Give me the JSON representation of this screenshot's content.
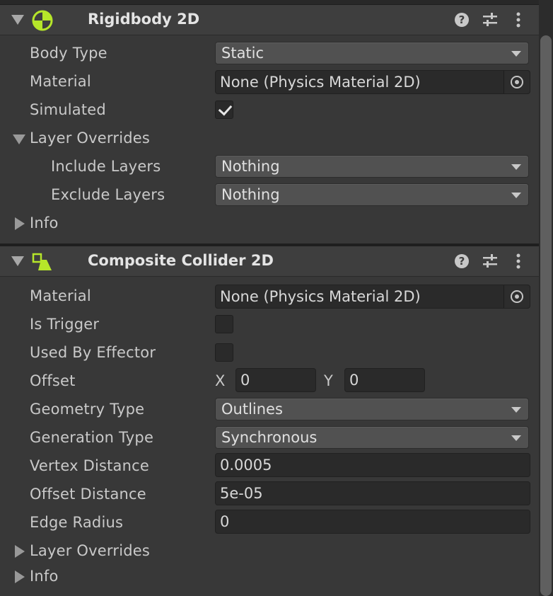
{
  "rigidbody": {
    "title": "Rigidbody 2D",
    "icon": "rigidbody2d-icon",
    "accent": "#b6e62a",
    "body_type_label": "Body Type",
    "body_type_value": "Static",
    "material_label": "Material",
    "material_value": "None (Physics Material 2D)",
    "simulated_label": "Simulated",
    "simulated_checked": true,
    "layer_overrides_label": "Layer Overrides",
    "include_layers_label": "Include Layers",
    "include_layers_value": "Nothing",
    "exclude_layers_label": "Exclude Layers",
    "exclude_layers_value": "Nothing",
    "info_label": "Info"
  },
  "composite": {
    "title": "Composite Collider 2D",
    "icon": "composite-collider2d-icon",
    "accent": "#b6e62a",
    "material_label": "Material",
    "material_value": "None (Physics Material 2D)",
    "is_trigger_label": "Is Trigger",
    "is_trigger_checked": false,
    "used_by_effector_label": "Used By Effector",
    "used_by_effector_checked": false,
    "offset_label": "Offset",
    "offset_x_label": "X",
    "offset_x_value": "0",
    "offset_y_label": "Y",
    "offset_y_value": "0",
    "geometry_type_label": "Geometry Type",
    "geometry_type_value": "Outlines",
    "generation_type_label": "Generation Type",
    "generation_type_value": "Synchronous",
    "vertex_distance_label": "Vertex Distance",
    "vertex_distance_value": "0.0005",
    "offset_distance_label": "Offset Distance",
    "offset_distance_value": "5e-05",
    "edge_radius_label": "Edge Radius",
    "edge_radius_value": "0",
    "layer_overrides_label": "Layer Overrides",
    "info_label": "Info"
  },
  "header_icons": [
    "help-icon",
    "presets-icon",
    "kebab-menu-icon"
  ],
  "colors": {
    "panel_bg": "#383838",
    "header_bg": "#3e3e3e",
    "field_bg": "#2a2a2a",
    "dropdown_bg": "#515151"
  }
}
